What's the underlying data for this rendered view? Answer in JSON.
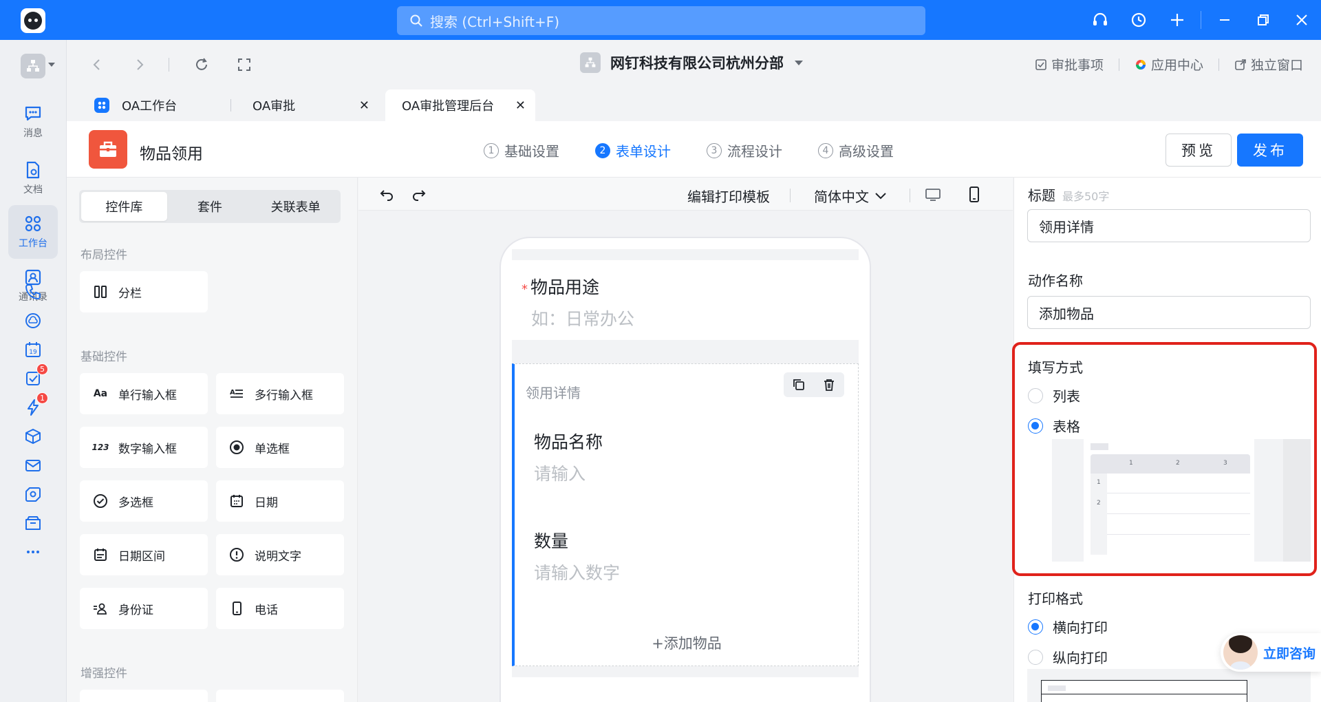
{
  "titlebar": {
    "search_placeholder": "搜索 (Ctrl+Shift+F)",
    "accent": "#1677ff"
  },
  "dock": {
    "items": [
      {
        "label": "消息",
        "icon": "message-icon"
      },
      {
        "label": "文档",
        "icon": "document-icon"
      },
      {
        "label": "工作台",
        "icon": "workbench-icon",
        "active": true
      },
      {
        "label": "通讯录",
        "icon": "contacts-icon"
      }
    ],
    "extra_icons": [
      {
        "icon": "phone-call-icon"
      },
      {
        "icon": "cloud-icon"
      },
      {
        "icon": "calendar-icon",
        "text": "19"
      },
      {
        "icon": "todo-icon",
        "badge": "5"
      },
      {
        "icon": "lightning-icon",
        "badge": "1"
      },
      {
        "icon": "cube-icon"
      },
      {
        "icon": "mail-icon"
      },
      {
        "icon": "drive-icon"
      },
      {
        "icon": "folder-icon"
      },
      {
        "icon": "more-icon"
      }
    ]
  },
  "nav": {
    "company": "网钉科技有限公司杭州分部",
    "links": [
      "审批事项",
      "应用中心",
      "独立窗口"
    ]
  },
  "tabs": [
    {
      "label": "OA工作台"
    },
    {
      "label": "OA审批"
    },
    {
      "label": "OA审批管理后台",
      "active": true
    }
  ],
  "app": {
    "name": "物品领用",
    "steps": [
      {
        "num": "1",
        "label": "基础设置"
      },
      {
        "num": "2",
        "label": "表单设计",
        "active": true
      },
      {
        "num": "3",
        "label": "流程设计"
      },
      {
        "num": "4",
        "label": "高级设置"
      }
    ],
    "preview_label": "预览",
    "publish_label": "发布"
  },
  "widgets": {
    "tabs": [
      "控件库",
      "套件",
      "关联表单"
    ],
    "layout_title": "布局控件",
    "layout_items": [
      {
        "label": "分栏",
        "icon": "columns-icon"
      }
    ],
    "basic_title": "基础控件",
    "basic_items": [
      {
        "label": "单行输入框",
        "icon": "text-input-icon",
        "glyph": "Aa"
      },
      {
        "label": "多行输入框",
        "icon": "textarea-icon"
      },
      {
        "label": "数字输入框",
        "icon": "number-input-icon",
        "glyph": "123"
      },
      {
        "label": "单选框",
        "icon": "radio-icon"
      },
      {
        "label": "多选框",
        "icon": "checkbox-icon"
      },
      {
        "label": "日期",
        "icon": "date-icon"
      },
      {
        "label": "日期区间",
        "icon": "date-range-icon"
      },
      {
        "label": "说明文字",
        "icon": "info-icon"
      },
      {
        "label": "身份证",
        "icon": "id-card-icon"
      },
      {
        "label": "电话",
        "icon": "phone-icon"
      }
    ],
    "enhanced_title": "增强控件"
  },
  "canvas": {
    "print_template": "编辑打印模板",
    "language": "简体中文",
    "fields": {
      "purpose_label": "物品用途",
      "purpose_placeholder": "如：日常办公",
      "detail_title": "领用详情",
      "name_label": "物品名称",
      "name_placeholder": "请输入",
      "qty_label": "数量",
      "qty_placeholder": "请输入数字",
      "add_item": "+添加物品"
    }
  },
  "props": {
    "title_label": "标题",
    "title_hint": "最多50字",
    "title_value": "领用详情",
    "action_label": "动作名称",
    "action_value": "添加物品",
    "fill_mode_label": "填写方式",
    "fill_modes": [
      {
        "label": "列表",
        "selected": false
      },
      {
        "label": "表格",
        "selected": true
      }
    ],
    "table_cols": [
      "1",
      "2",
      "3"
    ],
    "table_rows": [
      "1",
      "2"
    ],
    "print_format_label": "打印格式",
    "print_formats": [
      {
        "label": "横向打印",
        "selected": true
      },
      {
        "label": "纵向打印",
        "selected": false
      }
    ],
    "highlight_color": "#e0221b"
  },
  "consult": {
    "label": "立即咨询"
  }
}
